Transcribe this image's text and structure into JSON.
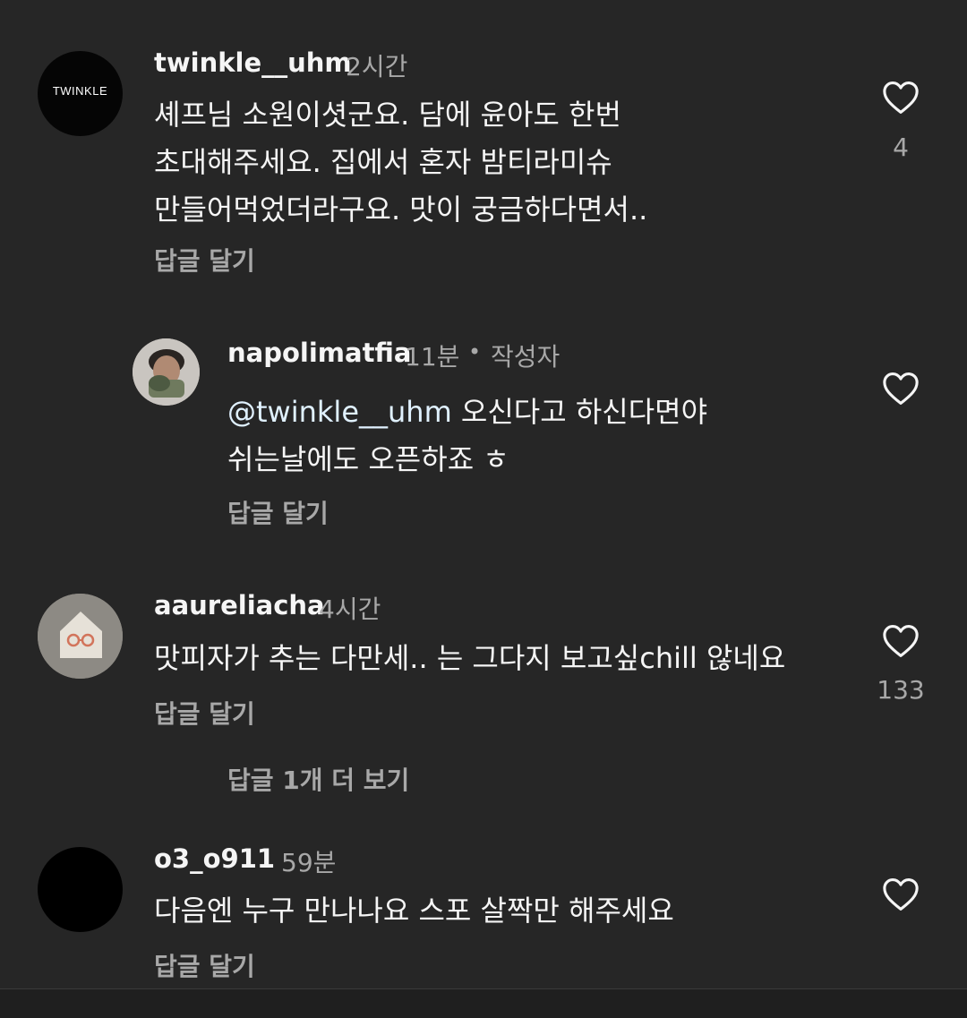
{
  "comments": [
    {
      "username": "twinkle__uhm",
      "time": "2시간",
      "avatar_text": "TWINKLE",
      "lines": [
        "셰프님 소원이셧군요. 담에 윤아도 한번",
        "초대해주세요. 집에서 혼자 밤티라미슈",
        "만들어먹었더라구요. 맛이 궁금하다면서.."
      ],
      "reply_label": "답글 달기",
      "likes": "4"
    },
    {
      "username": "napolimatfia",
      "time": "11분",
      "author_badge": "작성자",
      "mention": "@twinkle__uhm",
      "line1_rest": " 오신다고 하신다면야",
      "line2": "쉬는날에도 오픈하죠 ㅎ",
      "reply_label": "답글 달기"
    },
    {
      "username": "aaureliacha",
      "time": "4시간",
      "line": "맛피자가 추는 다만세.. 는 그다지 보고싶chill 않네요",
      "reply_label": "답글 달기",
      "likes": "133",
      "view_more": "답글 1개 더 보기"
    },
    {
      "username": "o3_o911",
      "time": "59분",
      "line": "다음엔 누구 만나나요 스포 살짝만 해주세요",
      "reply_label": "답글 달기"
    }
  ],
  "separator": "•"
}
